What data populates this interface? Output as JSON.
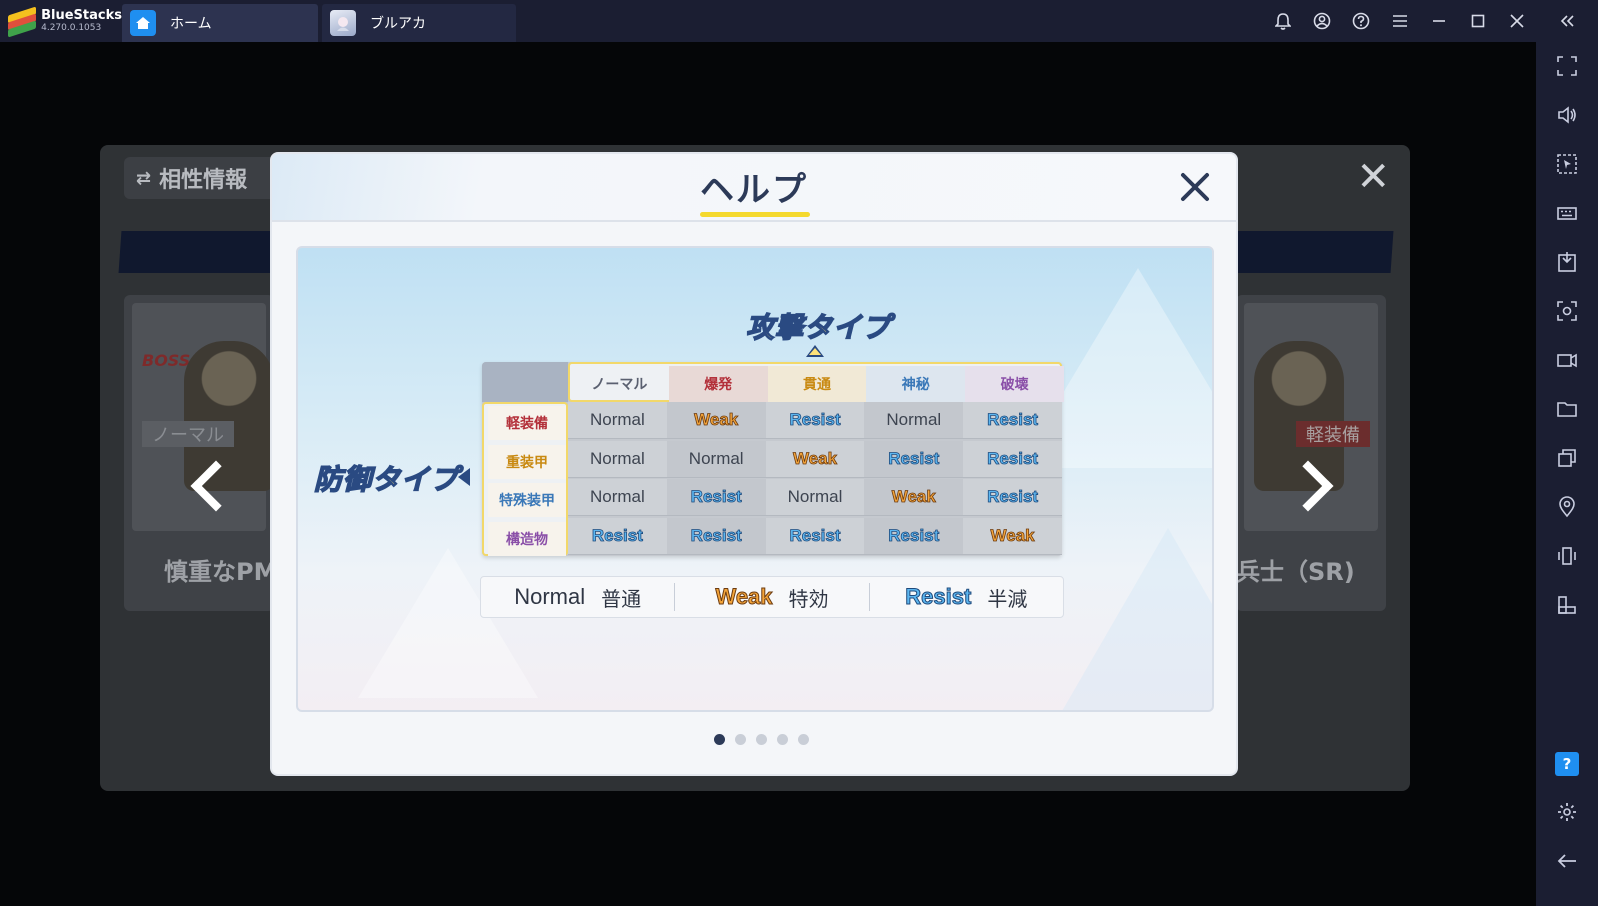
{
  "app": {
    "name": "BlueStacks",
    "version": "4.270.0.1053",
    "tabs": [
      {
        "label": "ホーム"
      },
      {
        "label": "ブルアカ"
      }
    ]
  },
  "background": {
    "panel_title": "相性情報",
    "card_left_name": "慎重なPM(",
    "card_right_name": "兵士（SR)",
    "card_left_badge": "ノーマル",
    "card_right_badge": "軽装備",
    "boss_tag": "BOSS"
  },
  "dialog": {
    "title": "ヘルプ",
    "attack_label": "攻撃タイプ",
    "defense_label": "防御タイプ",
    "columns": [
      {
        "label": "ノーマル",
        "color": "#5a6070"
      },
      {
        "label": "爆発",
        "color": "#b3303a"
      },
      {
        "label": "貫通",
        "color": "#c98a12"
      },
      {
        "label": "神秘",
        "color": "#3a78b8"
      },
      {
        "label": "破壊",
        "color": "#8a4fa8"
      }
    ],
    "rows": [
      {
        "label": "軽装備",
        "color": "#b3303a",
        "cells": [
          "Normal",
          "Weak",
          "Resist",
          "Normal",
          "Resist"
        ]
      },
      {
        "label": "重装甲",
        "color": "#c98a12",
        "cells": [
          "Normal",
          "Normal",
          "Weak",
          "Resist",
          "Resist"
        ]
      },
      {
        "label": "特殊装甲",
        "color": "#3a78b8",
        "cells": [
          "Normal",
          "Resist",
          "Normal",
          "Weak",
          "Resist"
        ]
      },
      {
        "label": "構造物",
        "color": "#8a4fa8",
        "cells": [
          "Resist",
          "Resist",
          "Resist",
          "Resist",
          "Weak"
        ]
      }
    ],
    "legend": [
      {
        "term": "Normal",
        "meaning": "普通"
      },
      {
        "term": "Weak",
        "meaning": "特効"
      },
      {
        "term": "Resist",
        "meaning": "半減"
      }
    ],
    "page_count": 5,
    "current_page": 1
  }
}
